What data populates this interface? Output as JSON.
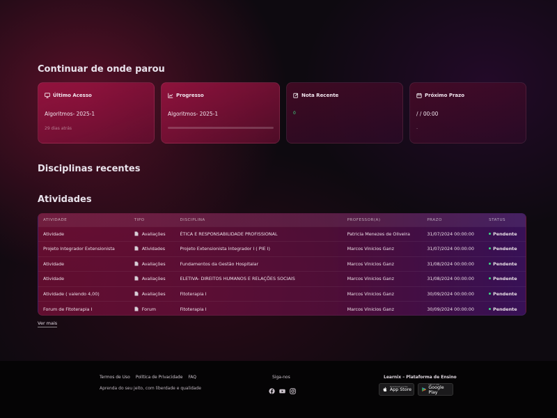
{
  "sections": {
    "continue": "Continuar de onde parou",
    "recent": "Disciplinas recentes",
    "activities": "Atividades"
  },
  "cards": [
    {
      "icon": "monitor-icon",
      "title": "Último Acesso",
      "value": "Algoritmos- 2025-1",
      "sub": "29 dias atrás"
    },
    {
      "icon": "chart-line-icon",
      "title": "Progresso",
      "value": "Algoritmos- 2025-1",
      "progress": 0
    },
    {
      "icon": "edit-note-icon",
      "title": "Nota Recente",
      "value": "",
      "sub": "0"
    },
    {
      "icon": "calendar-icon",
      "title": "Próximo Prazo",
      "value": "/ / 00:00",
      "sub": "-"
    }
  ],
  "table": {
    "headers": [
      "ATIVIDADE",
      "TIPO",
      "DISCIPLINA",
      "PROFESSOR(A)",
      "PRAZO",
      "STATUS"
    ],
    "rows": [
      {
        "atividade": "Atividade",
        "tipo": "Avaliações",
        "disciplina": "ÉTICA E RESPONSABILIDADE PROFISSIONAL",
        "professor": "Patricia Menezes de Oliveira",
        "prazo": "31/07/2024 00:00:00",
        "status": "Pendente"
      },
      {
        "atividade": "Projeto Integrador Extensionista",
        "tipo": "Atividades",
        "disciplina": "Projeto Extensionista Integrador I ( PIE I)",
        "professor": "Marcos Vinicios Ganz",
        "prazo": "31/07/2024 00:00:00",
        "status": "Pendente"
      },
      {
        "atividade": "Atividade",
        "tipo": "Avaliações",
        "disciplina": "Fundamentos da Gestão Hospitalar",
        "professor": "Marcos Vinicios Ganz",
        "prazo": "31/08/2024 00:00:00",
        "status": "Pendente"
      },
      {
        "atividade": "Atividade",
        "tipo": "Avaliações",
        "disciplina": "ELETIVA- DIREITOS HUMANOS E RELAÇÕES SOCIAIS",
        "professor": "Marcos Vinicios Ganz",
        "prazo": "31/08/2024 00:00:00",
        "status": "Pendente"
      },
      {
        "atividade": "Atividade ( valendo 4,00)",
        "tipo": "Avaliações",
        "disciplina": "Fitoterapia I",
        "professor": "Marcos Vinicios Ganz",
        "prazo": "30/09/2024 00:00:00",
        "status": "Pendente"
      },
      {
        "atividade": "Forum de Fitoterapia I",
        "tipo": "Forum",
        "disciplina": "Fitoterapia I",
        "professor": "Marcos Vinicios Ganz",
        "prazo": "30/09/2024 00:00:00",
        "status": "Pendente"
      }
    ]
  },
  "ver_mais": "Ver mais",
  "footer": {
    "links": [
      "Termos de Uso",
      "Política de Privacidade",
      "FAQ"
    ],
    "tagline": "Aprenda do seu jeito, com liberdade e qualidade",
    "follow": "Siga-nos",
    "social": [
      "facebook-icon",
      "youtube-icon",
      "instagram-icon"
    ],
    "brand": "Learnix – Plataforma de Ensino",
    "stores": [
      {
        "small": "Download on the",
        "name": "App Store"
      },
      {
        "small": "GET IT ON",
        "name": "Google Play"
      }
    ]
  },
  "colors": {
    "status_dot": "#3ddc84",
    "card_accent": "#aa1446",
    "progress": "#e24a8a"
  }
}
